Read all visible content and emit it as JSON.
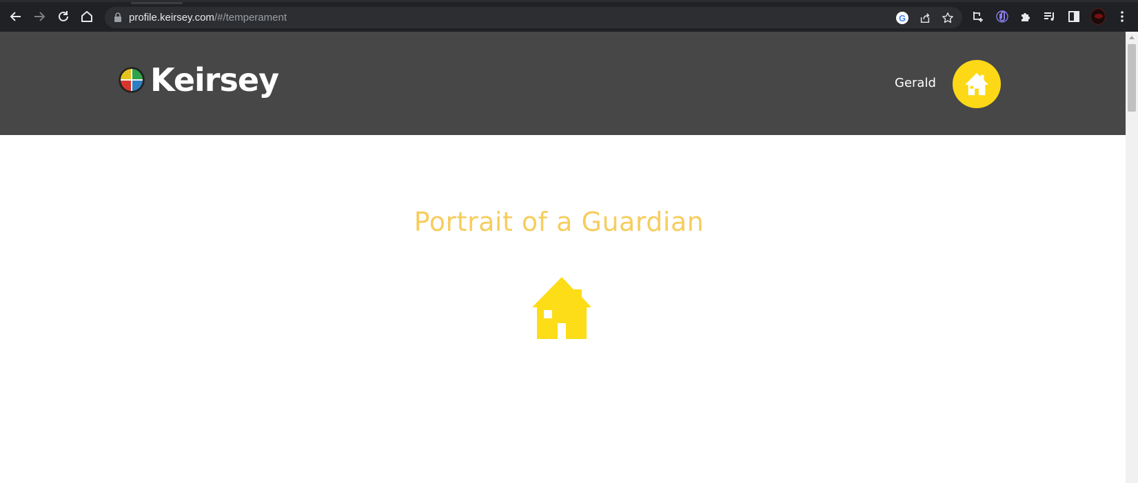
{
  "browser": {
    "url_host": "profile.keirsey.com",
    "url_path": "/#/temperament"
  },
  "site": {
    "brand": "Keirsey",
    "user_name": "Gerald"
  },
  "main": {
    "title": "Portrait of a Guardian"
  },
  "colors": {
    "header_bg": "#474747",
    "accent_yellow": "#fcd816",
    "title_color": "#f6cd5e"
  },
  "icons": {
    "temperament_icon": "house-icon",
    "avatar_icon": "house-icon"
  }
}
